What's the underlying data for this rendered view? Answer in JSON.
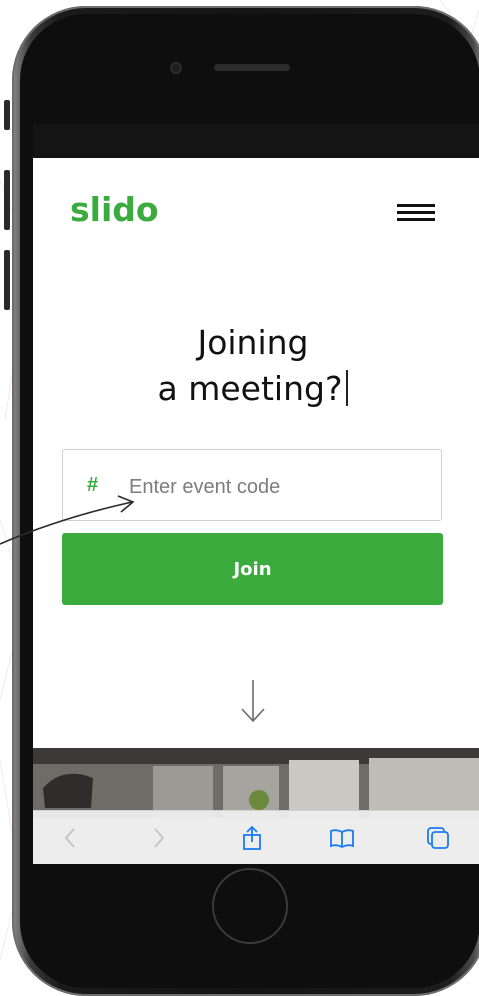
{
  "app": {
    "logo_text": "slido"
  },
  "header": {
    "menu_icon": "hamburger-menu-icon"
  },
  "hero": {
    "headline_line1": "Joining",
    "headline_line2": "a meeting?"
  },
  "event_code": {
    "prefix": "#",
    "value": "",
    "placeholder": "Enter event code"
  },
  "join_button": {
    "label": "Join"
  },
  "scroll_hint": {
    "icon": "arrow-down-icon"
  },
  "browser_toolbar": {
    "icons": [
      "back-icon",
      "forward-icon",
      "share-icon",
      "bookmarks-icon",
      "tabs-icon"
    ]
  },
  "colors": {
    "brand_green": "#3bab3e",
    "text_dark": "#111111",
    "phone_frame": "#141414",
    "ios_toolbar_tint": "#1a7bf2"
  }
}
